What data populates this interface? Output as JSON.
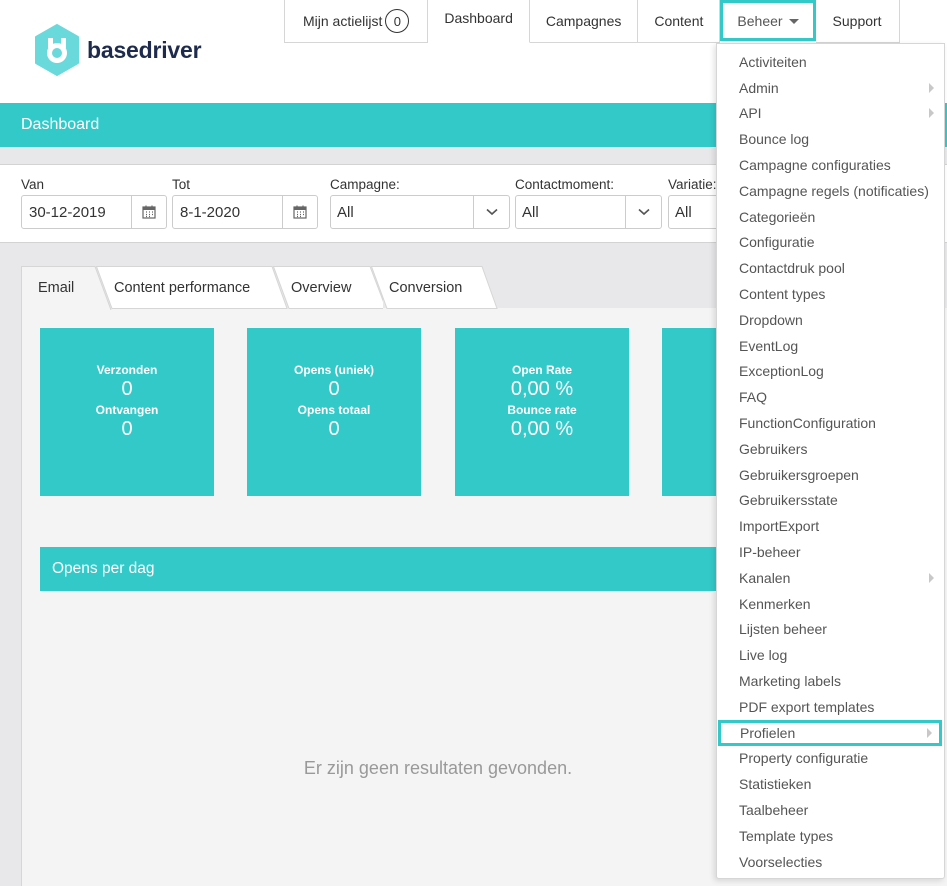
{
  "brand": {
    "name": "basedriver",
    "accent": "#33c9c9",
    "logo_icon": "hexagon-robot-icon"
  },
  "nav": {
    "items": [
      {
        "label": "Mijn actielijst",
        "badge": "0"
      },
      {
        "label": "Dashboard",
        "active": true
      },
      {
        "label": "Campagnes"
      },
      {
        "label": "Content"
      },
      {
        "label": "Beheer",
        "has_dropdown": true,
        "open": true
      },
      {
        "label": "Support"
      }
    ]
  },
  "page": {
    "title": "Dashboard"
  },
  "filters": {
    "van": {
      "label": "Van",
      "value": "30-12-2019",
      "icon": "calendar-icon"
    },
    "tot": {
      "label": "Tot",
      "value": "8-1-2020",
      "icon": "calendar-icon"
    },
    "campagne": {
      "label": "Campagne:",
      "value": "All"
    },
    "contactmoment": {
      "label": "Contactmoment:",
      "value": "All"
    },
    "variatie": {
      "label": "Variatie:",
      "value": "All"
    }
  },
  "tabs": [
    {
      "label": "Email",
      "active": true
    },
    {
      "label": "Content performance"
    },
    {
      "label": "Overview"
    },
    {
      "label": "Conversion"
    }
  ],
  "stats": [
    {
      "label1": "Verzonden",
      "value1": "0",
      "label2": "Ontvangen",
      "value2": "0"
    },
    {
      "label1": "Opens (uniek)",
      "value1": "0",
      "label2": "Opens totaal",
      "value2": "0"
    },
    {
      "label1": "Open Rate",
      "value1": "0,00 %",
      "label2": "Bounce rate",
      "value2": "0,00 %"
    }
  ],
  "section": {
    "title": "Opens per dag",
    "empty_message": "Er zijn geen resultaten gevonden."
  },
  "beheer_menu": {
    "items": [
      {
        "label": "Activiteiten"
      },
      {
        "label": "Admin",
        "submenu": true
      },
      {
        "label": "API",
        "submenu": true
      },
      {
        "label": "Bounce log"
      },
      {
        "label": "Campagne configuraties"
      },
      {
        "label": "Campagne regels (notificaties)"
      },
      {
        "label": "Categorieën"
      },
      {
        "label": "Configuratie"
      },
      {
        "label": "Contactdruk pool"
      },
      {
        "label": "Content types"
      },
      {
        "label": "Dropdown"
      },
      {
        "label": "EventLog"
      },
      {
        "label": "ExceptionLog"
      },
      {
        "label": "FAQ"
      },
      {
        "label": "FunctionConfiguration"
      },
      {
        "label": "Gebruikers"
      },
      {
        "label": "Gebruikersgroepen"
      },
      {
        "label": "Gebruikersstate"
      },
      {
        "label": "ImportExport"
      },
      {
        "label": "IP-beheer"
      },
      {
        "label": "Kanalen",
        "submenu": true
      },
      {
        "label": "Kenmerken"
      },
      {
        "label": "Lijsten beheer"
      },
      {
        "label": "Live log"
      },
      {
        "label": "Marketing labels"
      },
      {
        "label": "PDF export templates"
      },
      {
        "label": "Profielen",
        "submenu": true,
        "highlighted": true
      },
      {
        "label": "Property configuratie"
      },
      {
        "label": "Statistieken"
      },
      {
        "label": "Taalbeheer"
      },
      {
        "label": "Template types"
      },
      {
        "label": "Voorselecties"
      }
    ]
  }
}
